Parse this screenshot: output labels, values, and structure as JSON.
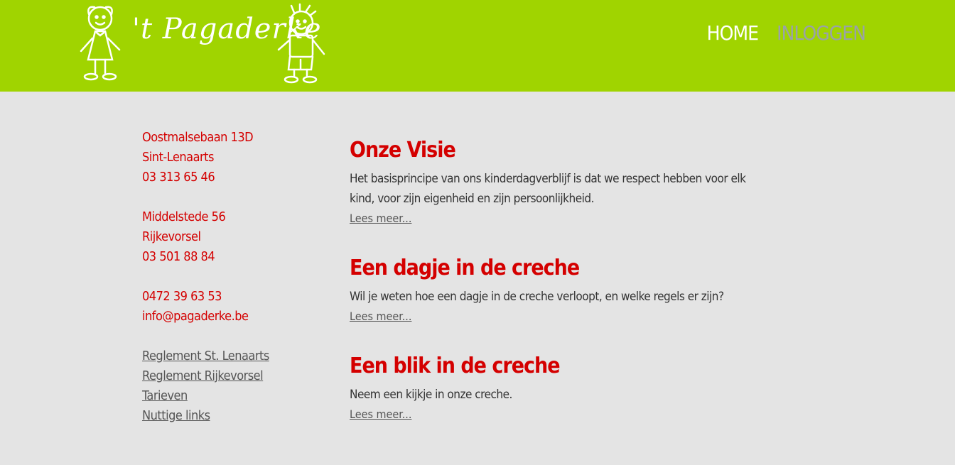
{
  "header": {
    "logo_text": "'t Pagaderke",
    "nav": {
      "home": "HOME",
      "login": "INLOGGEN"
    }
  },
  "sidebar": {
    "location1": {
      "street": "Oostmalsebaan 13D",
      "city": "Sint-Lenaarts",
      "phone": "03 313 65 46"
    },
    "location2": {
      "street": "Middelstede 56",
      "city": "Rijkevorsel",
      "phone": "03 501 88 84"
    },
    "contact": {
      "mobile": "0472 39 63 53",
      "email": "info@pagaderke.be"
    },
    "links": [
      "Reglement St. Lenaarts",
      "Reglement Rijkevorsel",
      "Tarieven",
      "Nuttige links"
    ]
  },
  "articles": [
    {
      "title": "Onze Visie",
      "text": "Het basisprincipe van ons kinderdagverblijf is dat we respect hebben voor elk kind, voor zijn eigenheid en zijn persoonlijkheid.",
      "more": "Lees meer..."
    },
    {
      "title": "Een dagje in de creche",
      "text": "Wil je weten hoe een dagje in de creche verloopt, en welke regels er zijn?",
      "more": "Lees meer..."
    },
    {
      "title": "Een blik in de creche",
      "text": "Neem een kijkje in onze creche.",
      "more": "Lees meer..."
    }
  ],
  "colors": {
    "header_bg": "#a0d400",
    "accent_red": "#d40000",
    "page_bg": "#e4e4e4"
  }
}
